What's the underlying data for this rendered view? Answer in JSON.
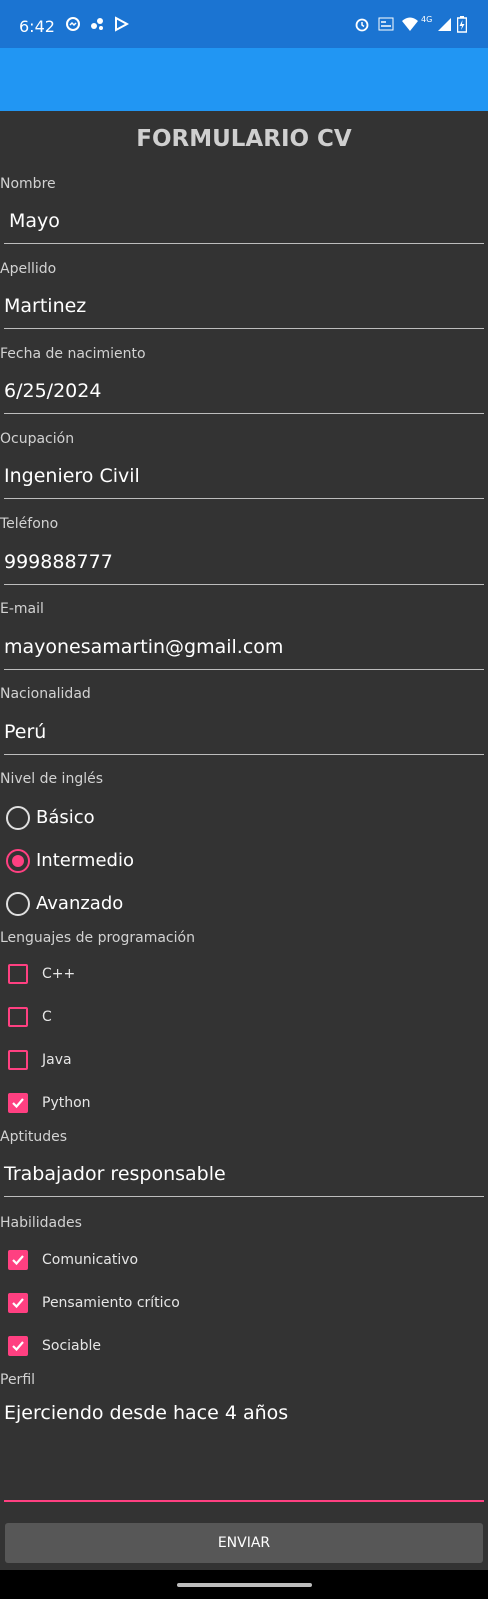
{
  "status_bar": {
    "time": "6:42",
    "left_icons": [
      "messenger-icon",
      "connection-icon",
      "play-store-icon"
    ],
    "right_icons": [
      "alarm-icon",
      "volte-icon",
      "wifi-icon",
      "signal-icon",
      "battery-icon"
    ],
    "network_label": "4G"
  },
  "colors": {
    "status_bar": "#1b74d2",
    "app_bar": "#2196f3",
    "background": "#333333",
    "accent": "#ff4081",
    "button": "#575757"
  },
  "form": {
    "title": "FORMULARIO CV",
    "fields": {
      "nombre": {
        "label": "Nombre",
        "value": "Mayo"
      },
      "apellido": {
        "label": "Apellido",
        "value": "Martinez"
      },
      "fecha": {
        "label": "Fecha de nacimiento",
        "value": "6/25/2024"
      },
      "ocupacion": {
        "label": "Ocupación",
        "value": "Ingeniero Civil"
      },
      "telefono": {
        "label": "Teléfono",
        "value": "999888777"
      },
      "email": {
        "label": "E-mail",
        "value": "mayonesamartin@gmail.com"
      },
      "nacionalidad": {
        "label": "Nacionalidad",
        "value": "Perú"
      }
    },
    "ingles": {
      "label": "Nivel de inglés",
      "options": [
        "Básico",
        "Intermedio",
        "Avanzado"
      ],
      "selected": "Intermedio"
    },
    "lenguajes": {
      "label": "Lenguajes de programación",
      "options": [
        {
          "label": "C++",
          "checked": false
        },
        {
          "label": "C",
          "checked": false
        },
        {
          "label": "Java",
          "checked": false
        },
        {
          "label": "Python",
          "checked": true
        }
      ]
    },
    "aptitudes": {
      "label": "Aptitudes",
      "value": "Trabajador responsable"
    },
    "habilidades": {
      "label": "Habilidades",
      "options": [
        {
          "label": "Comunicativo",
          "checked": true
        },
        {
          "label": "Pensamiento crítico",
          "checked": true
        },
        {
          "label": "Sociable",
          "checked": true
        }
      ]
    },
    "perfil": {
      "label": "Perfil",
      "value": "Ejerciendo desde hace 4 años"
    },
    "submit_label": "ENVIAR"
  }
}
